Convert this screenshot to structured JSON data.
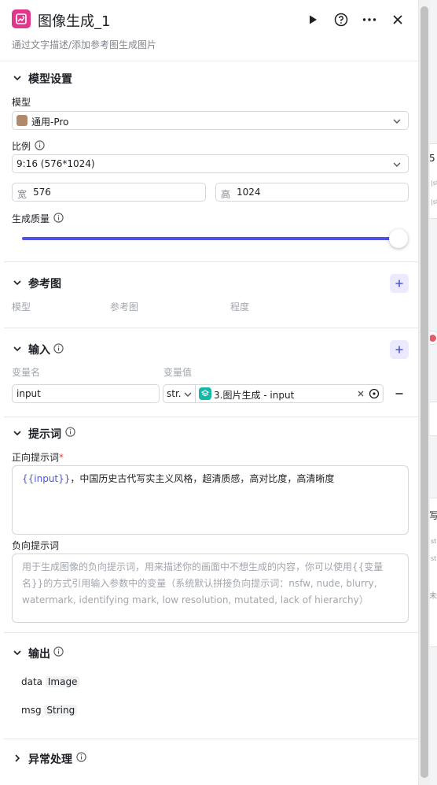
{
  "node": {
    "title": "图像生成_1",
    "subtitle": "通过文字描述/添加参考图生成图片",
    "accent": "#e0368b"
  },
  "header_actions": [
    "play-icon",
    "help-icon",
    "more-icon",
    "close-icon"
  ],
  "model_settings": {
    "section_title": "模型设置",
    "model_label": "模型",
    "model_value": "通用-Pro",
    "ratio_label": "比例",
    "ratio_value": "9:16 (576*1024)",
    "width_prefix": "宽",
    "width_value": "576",
    "height_prefix": "高",
    "height_value": "1024",
    "quality_label": "生成质量",
    "quality_level": 1.0
  },
  "reference": {
    "section_title": "参考图",
    "columns": [
      "模型",
      "参考图",
      "程度"
    ]
  },
  "inputs": {
    "section_title": "输入",
    "col_name": "变量名",
    "col_value": "变量值",
    "row": {
      "name": "input",
      "type": "str.",
      "value_ref": "3.图片生成 - input"
    }
  },
  "prompt": {
    "section_title": "提示词",
    "positive_label": "正向提示词",
    "required_mark": "*",
    "positive_var": "{{input}}",
    "positive_text": "，中国历史古代写实主义风格，超清质感，高对比度，高清晰度",
    "negative_label": "负向提示词",
    "negative_placeholder": "用于生成图像的负向提示词，用来描述你的画面中不想生成的内容，你可以使用{{变量名}}的方式引用输入参数中的变量（系统默认拼接负向提示词：nsfw, nude, blurry, watermark, identifying mark, low resolution, mutated, lack of hierarchy）"
  },
  "output": {
    "section_title": "输出",
    "fields": [
      {
        "name": "data",
        "type": "Image"
      },
      {
        "name": "msg",
        "type": "String"
      }
    ]
  },
  "exception": {
    "section_title": "异常处理"
  },
  "background": {
    "node_a_title": "5",
    "node_b_title": "写",
    "node_b_row": "未"
  },
  "colors": {
    "primary": "#4d53e8",
    "required": "#e53e3e"
  }
}
